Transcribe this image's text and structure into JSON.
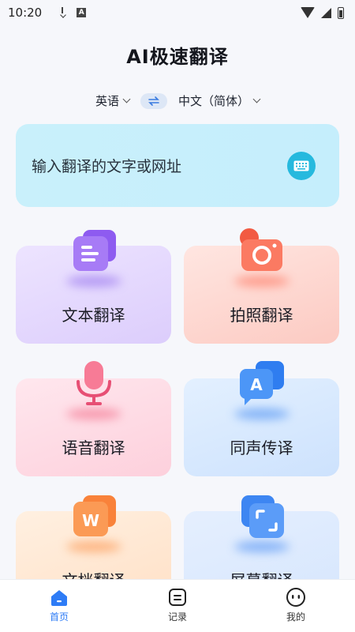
{
  "status_bar": {
    "time": "10:20",
    "icons": [
      "download-icon",
      "a-notification-icon",
      "wifi-icon",
      "signal-icon",
      "battery-icon"
    ]
  },
  "header": {
    "title": "AI极速翻译"
  },
  "language": {
    "source": "英语",
    "target": "中文（简体）",
    "swap_icon": "swap-arrows-icon"
  },
  "input": {
    "placeholder": "输入翻译的文字或网址",
    "keyboard_icon": "keyboard-icon"
  },
  "features": [
    {
      "label": "文本翻译",
      "icon": "document-text-icon"
    },
    {
      "label": "拍照翻译",
      "icon": "camera-icon"
    },
    {
      "label": "语音翻译",
      "icon": "microphone-icon"
    },
    {
      "label": "同声传译",
      "icon": "speech-bubble-a-icon"
    },
    {
      "label": "文档翻译",
      "icon": "word-document-icon"
    },
    {
      "label": "屏幕翻译",
      "icon": "screen-capture-icon"
    }
  ],
  "tabbar": {
    "items": [
      {
        "label": "首页",
        "icon": "home-icon",
        "active": true
      },
      {
        "label": "记录",
        "icon": "record-icon",
        "active": false
      },
      {
        "label": "我的",
        "icon": "profile-face-icon",
        "active": false
      }
    ]
  },
  "colors": {
    "accent": "#2e7cf6",
    "keyboard_button": "#26b9de",
    "input_bg": "#c9f0fb"
  }
}
